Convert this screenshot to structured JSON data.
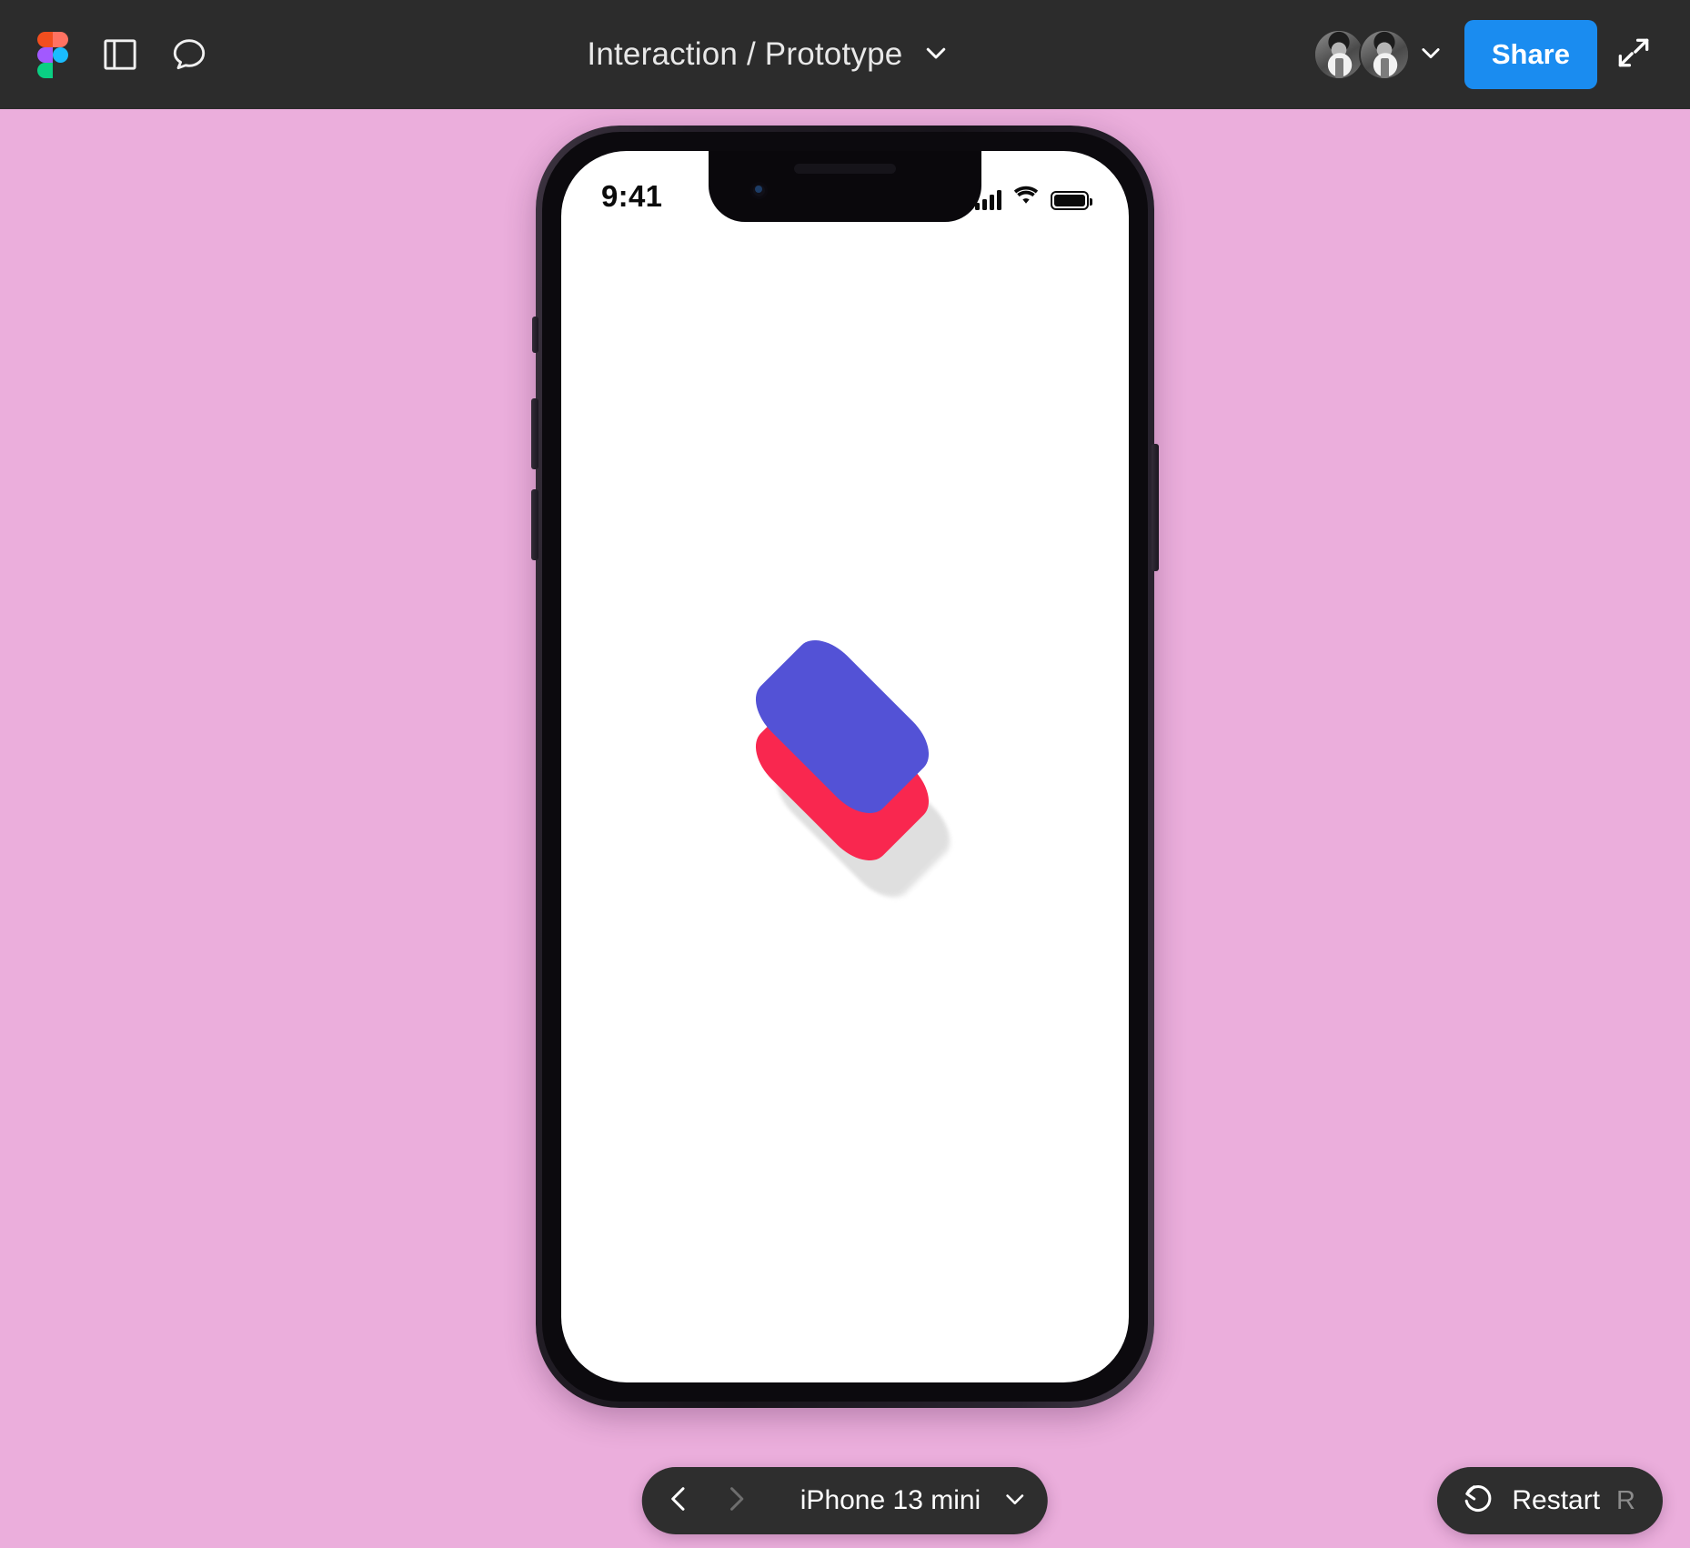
{
  "header": {
    "logo": "figma-logo",
    "sidebar_toggle_icon": "panel-layout-icon",
    "comment_icon": "comment-bubble-icon",
    "title": "Interaction / Prototype",
    "title_chevron_icon": "chevron-down-icon",
    "avatars": [
      {
        "name": "collaborator-1"
      },
      {
        "name": "collaborator-2"
      }
    ],
    "avatars_chevron_icon": "chevron-down-icon",
    "share_label": "Share",
    "fullscreen_icon": "fullscreen-expand-icon",
    "colors": {
      "bar_background": "#2C2C2C",
      "share_blue": "#1A8CF0",
      "title_text": "#E8E8E8"
    }
  },
  "canvas": {
    "background_color": "#EBAEDC"
  },
  "phone": {
    "model": "iPhone 13 mini",
    "statusbar": {
      "time": "9:41",
      "cellular_icon": "signal-bars-icon",
      "wifi_icon": "wifi-icon",
      "battery_icon": "battery-full-icon"
    },
    "screen": {
      "background_color": "#FFFFFF",
      "shapes": [
        {
          "name": "shadow-square",
          "color": "#DEDEDE"
        },
        {
          "name": "red-square",
          "color": "#F9274F"
        },
        {
          "name": "blue-square",
          "color": "#5352D6"
        }
      ]
    }
  },
  "bottom_bar": {
    "prev_icon": "chevron-left-icon",
    "next_icon": "chevron-right-icon",
    "device_name": "iPhone 13 mini",
    "device_chevron_icon": "chevron-down-icon",
    "restart_icon": "restart-rotate-icon",
    "restart_label": "Restart",
    "restart_shortcut": "R"
  }
}
